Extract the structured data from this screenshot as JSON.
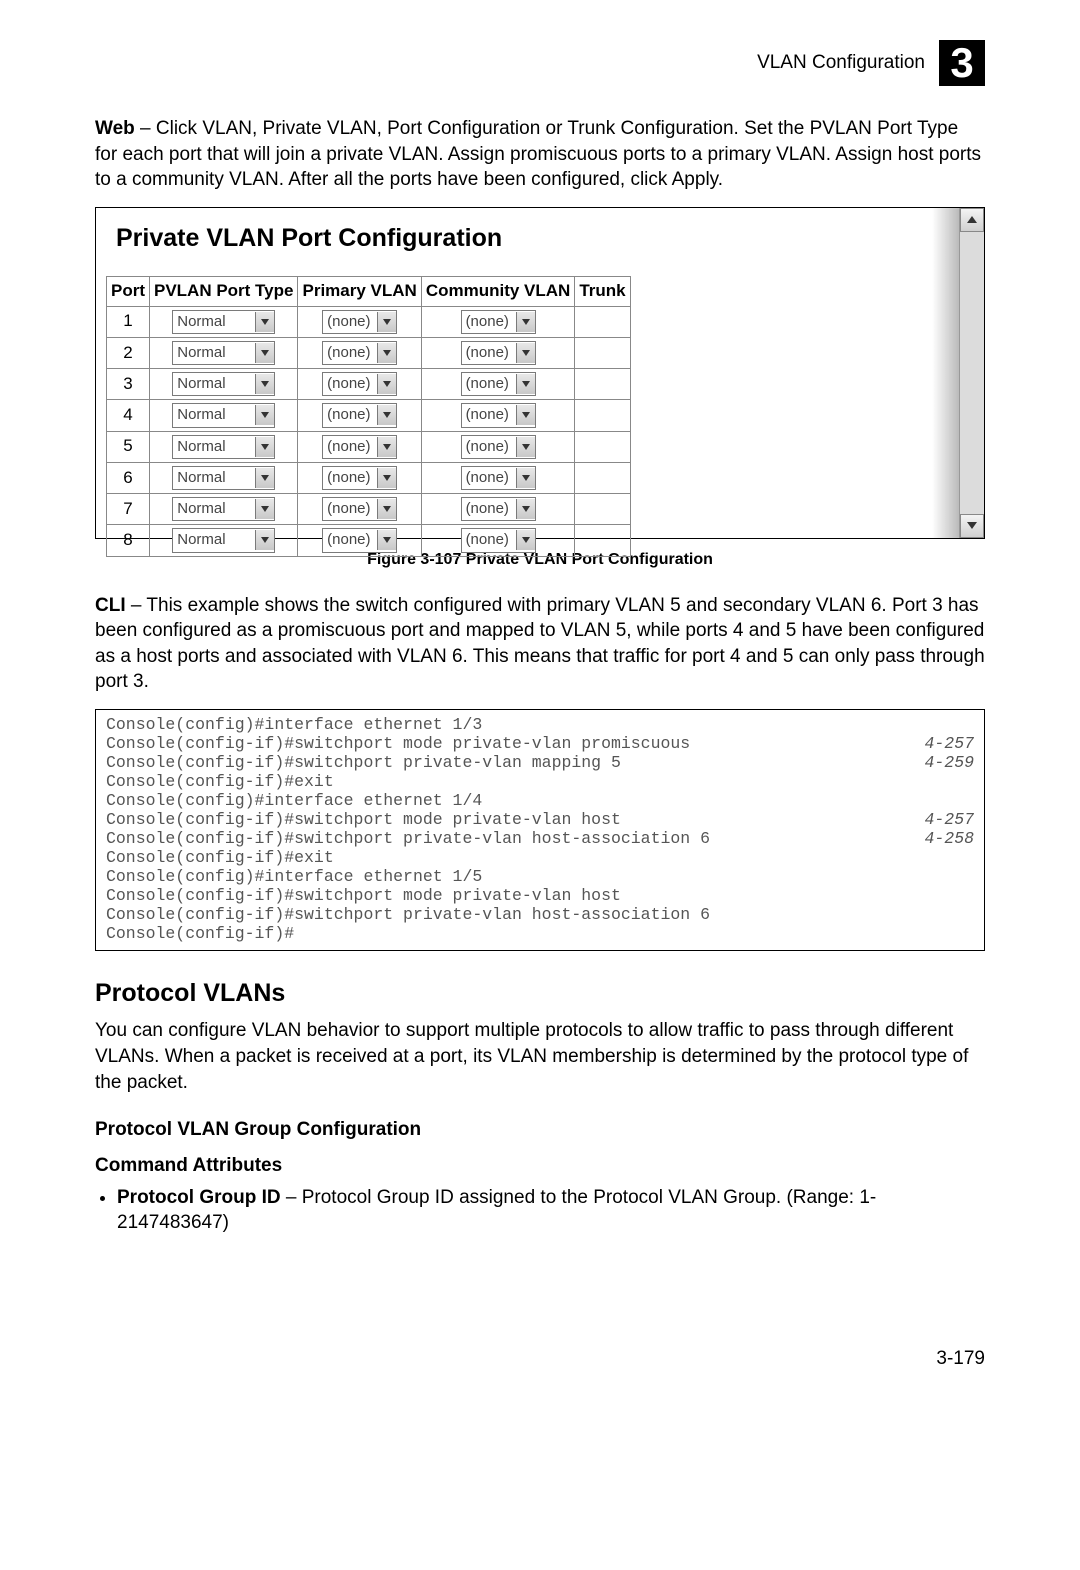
{
  "header": {
    "title": "VLAN Configuration",
    "chapter": "3"
  },
  "intro": {
    "lead": "Web",
    "text": " – Click VLAN, Private VLAN, Port Configuration or Trunk Configuration. Set the PVLAN Port Type for each port that will join a private VLAN. Assign promiscuous ports to a primary VLAN. Assign host ports to a community VLAN. After all the ports have been configured, click Apply."
  },
  "pane": {
    "title": "Private VLAN Port Configuration",
    "columns": [
      "Port",
      "PVLAN Port Type",
      "Primary VLAN",
      "Community VLAN",
      "Trunk"
    ],
    "rows": [
      {
        "port": "1",
        "type": "Normal",
        "primary": "(none)",
        "community": "(none)",
        "trunk": ""
      },
      {
        "port": "2",
        "type": "Normal",
        "primary": "(none)",
        "community": "(none)",
        "trunk": ""
      },
      {
        "port": "3",
        "type": "Normal",
        "primary": "(none)",
        "community": "(none)",
        "trunk": ""
      },
      {
        "port": "4",
        "type": "Normal",
        "primary": "(none)",
        "community": "(none)",
        "trunk": ""
      },
      {
        "port": "5",
        "type": "Normal",
        "primary": "(none)",
        "community": "(none)",
        "trunk": ""
      },
      {
        "port": "6",
        "type": "Normal",
        "primary": "(none)",
        "community": "(none)",
        "trunk": ""
      },
      {
        "port": "7",
        "type": "Normal",
        "primary": "(none)",
        "community": "(none)",
        "trunk": ""
      },
      {
        "port": "8",
        "type": "Normal",
        "primary": "(none)",
        "community": "(none)",
        "trunk": ""
      }
    ]
  },
  "caption": "Figure 3-107  Private VLAN Port Configuration",
  "cli_intro": {
    "lead": "CLI",
    "text": " – This example shows the switch configured with primary VLAN 5 and secondary VLAN 6. Port 3 has been configured as a promiscuous port and mapped to VLAN 5, while ports 4 and 5 have been configured as a host ports and associated with VLAN 6. This means that traffic for port 4 and 5 can only pass through port 3."
  },
  "cli": [
    {
      "cmd": "Console(config)#interface ethernet 1/3",
      "ref": ""
    },
    {
      "cmd": "Console(config-if)#switchport mode private-vlan promiscuous",
      "ref": "4-257"
    },
    {
      "cmd": "Console(config-if)#switchport private-vlan mapping 5",
      "ref": "4-259"
    },
    {
      "cmd": "Console(config-if)#exit",
      "ref": ""
    },
    {
      "cmd": "Console(config)#interface ethernet 1/4",
      "ref": ""
    },
    {
      "cmd": "Console(config-if)#switchport mode private-vlan host",
      "ref": "4-257"
    },
    {
      "cmd": "Console(config-if)#switchport private-vlan host-association 6",
      "ref": "4-258"
    },
    {
      "cmd": "Console(config-if)#exit",
      "ref": ""
    },
    {
      "cmd": "Console(config)#interface ethernet 1/5",
      "ref": ""
    },
    {
      "cmd": "Console(config-if)#switchport mode private-vlan host",
      "ref": ""
    },
    {
      "cmd": "Console(config-if)#switchport private-vlan host-association 6",
      "ref": ""
    },
    {
      "cmd": "Console(config-if)#",
      "ref": ""
    }
  ],
  "protocol": {
    "heading": "Protocol VLANs",
    "para": "You can configure VLAN behavior to support multiple protocols to allow traffic to pass through different VLANs. When a packet is received at a port, its VLAN membership is determined by the protocol type of the packet.",
    "sub": "Protocol VLAN Group Configuration",
    "attrs_heading": "Command Attributes",
    "bullet_lead": "Protocol Group ID",
    "bullet_text": " – Protocol Group ID assigned to the Protocol VLAN Group. (Range: 1-2147483647)"
  },
  "page_number": "3-179"
}
